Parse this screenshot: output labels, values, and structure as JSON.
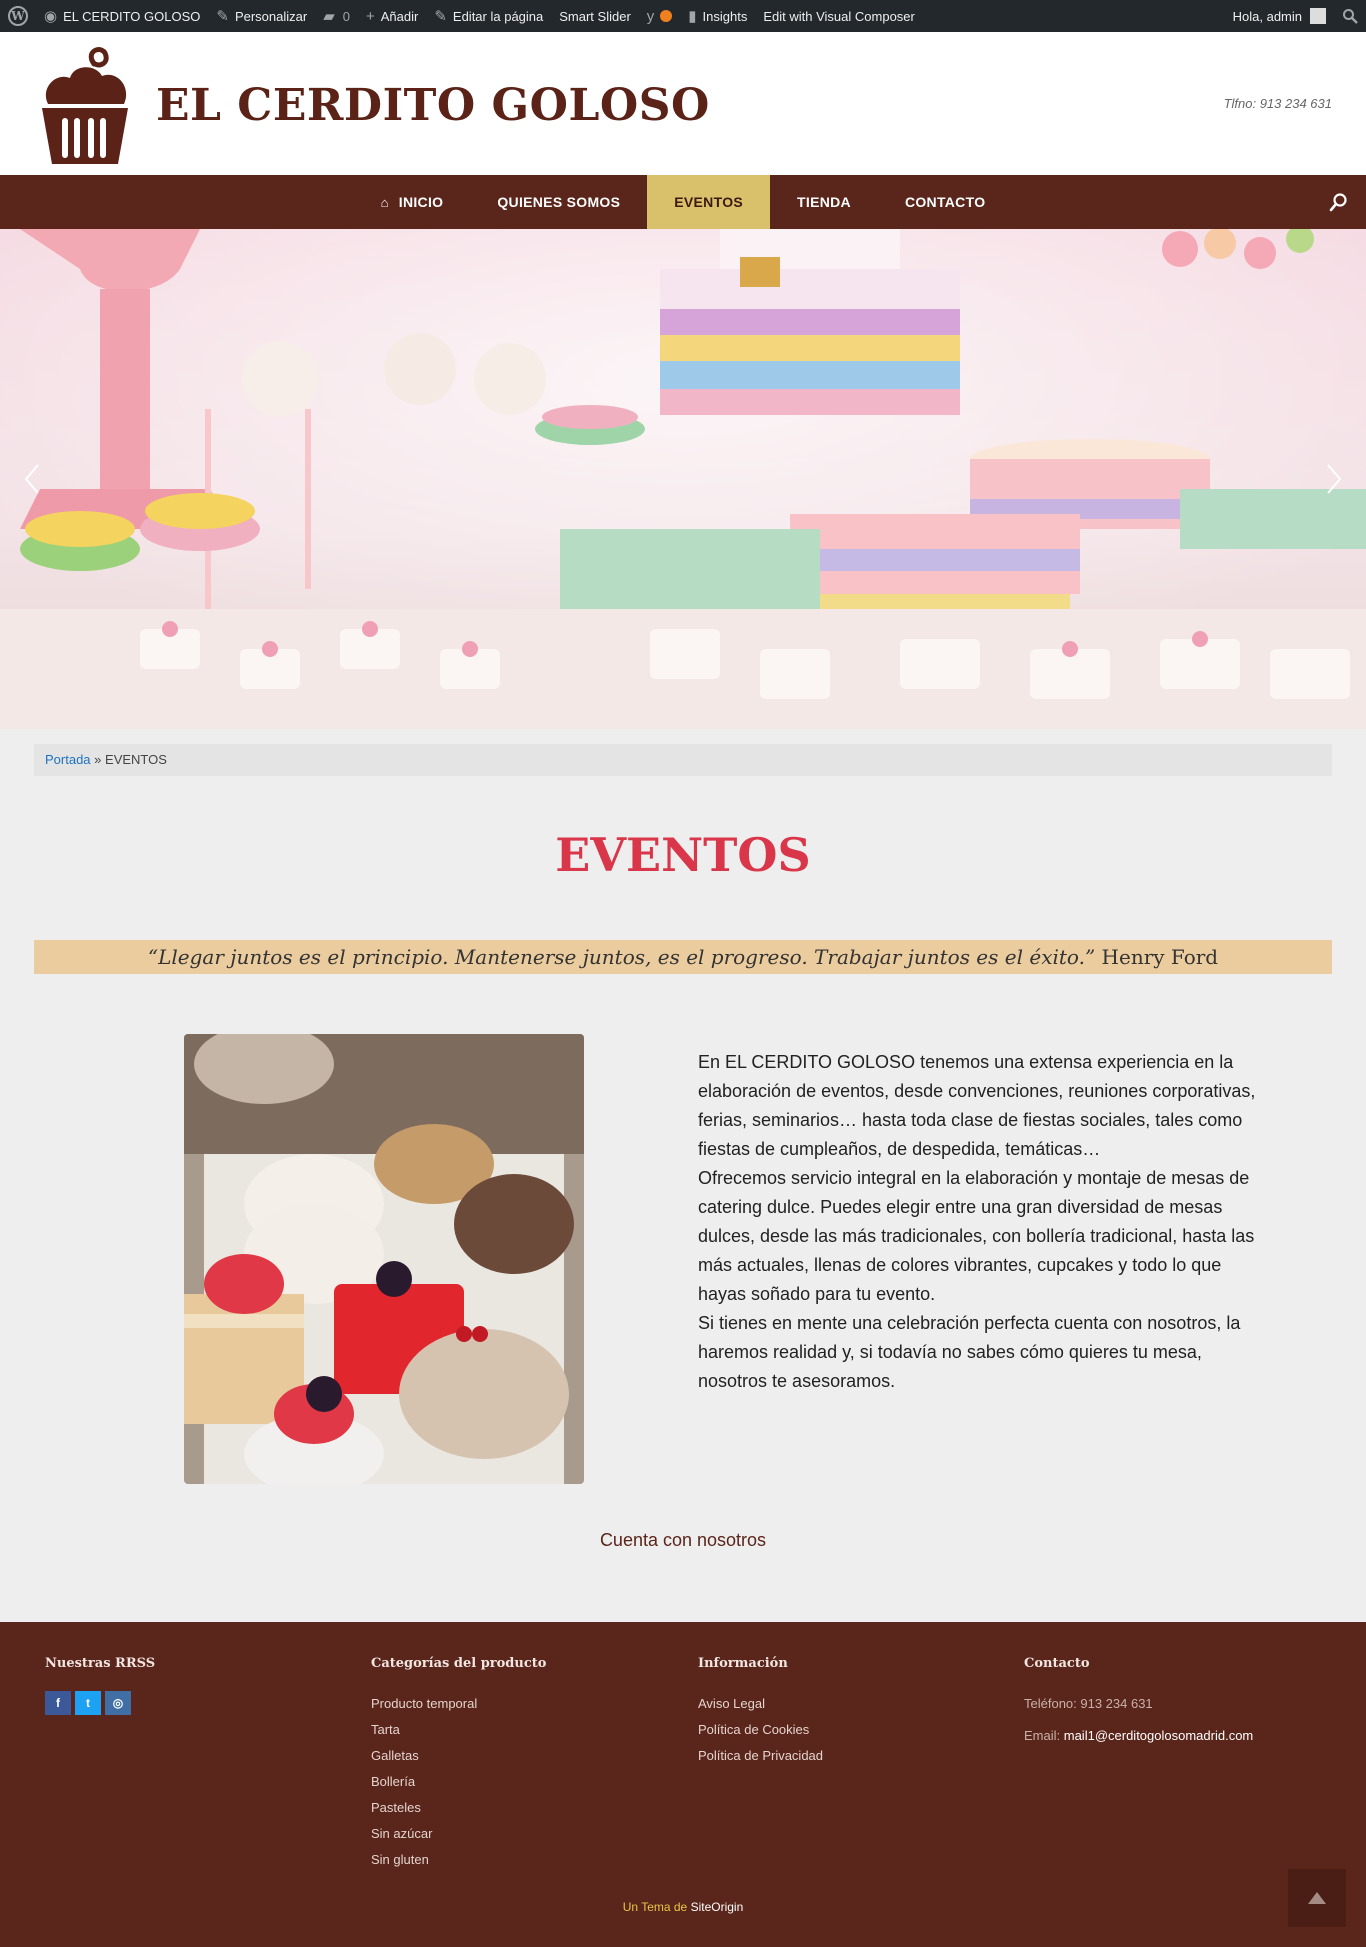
{
  "admin_bar": {
    "site_name": "EL CERDITO GOLOSO",
    "customize": "Personalizar",
    "comments_count": "0",
    "add_new": "Añadir",
    "edit_page": "Editar la página",
    "smart_slider": "Smart Slider",
    "insights": "Insights",
    "visual_composer": "Edit with Visual Composer",
    "greeting": "Hola, admin"
  },
  "header": {
    "site_title": "EL CERDITO GOLOSO",
    "phone": "Tlfno: 913 234 631"
  },
  "nav": {
    "items": [
      {
        "label": "INICIO"
      },
      {
        "label": "QUIENES SOMOS"
      },
      {
        "label": "EVENTOS"
      },
      {
        "label": "TIENDA"
      },
      {
        "label": "CONTACTO"
      }
    ]
  },
  "breadcrumb": {
    "home": "Portada",
    "separator": "»",
    "current": "EVENTOS"
  },
  "page": {
    "title": "EVENTOS",
    "quote_text": "“Llegar juntos es el principio. Mantenerse juntos, es el progreso. Trabajar juntos es el éxito.”",
    "quote_author": "Henry Ford",
    "paragraphs": [
      "En EL CERDITO GOLOSO tenemos una extensa experiencia en la elaboración de eventos, desde convenciones, reuniones corporativas, ferias, seminarios… hasta toda clase de fiestas sociales, tales como fiestas de cumpleaños, de despedida, temáticas…",
      "Ofrecemos servicio integral en la elaboración y montaje de mesas de catering dulce. Puedes elegir entre una gran diversidad de mesas dulces, desde las más tradicionales, con bollería tradicional, hasta las más actuales, llenas de colores vibrantes, cupcakes y todo lo que hayas soñado para tu evento.",
      "Si tienes en mente una celebración perfecta cuenta con nosotros, la haremos realidad y, si todavía no sabes cómo quieres tu mesa, nosotros te asesoramos."
    ],
    "cta": "Cuenta con nosotros"
  },
  "footer": {
    "rrss_title": "Nuestras RRSS",
    "social": [
      {
        "icon": "facebook-icon",
        "glyph": "f",
        "color": "#3b5998"
      },
      {
        "icon": "twitter-icon",
        "glyph": "t",
        "color": "#1da1f2"
      },
      {
        "icon": "instagram-icon",
        "glyph": "◎",
        "color": "#3f6fa5"
      }
    ],
    "categories_title": "Categorías del producto",
    "categories": [
      "Producto temporal",
      "Tarta",
      "Galletas",
      "Bollería",
      "Pasteles",
      "Sin azúcar",
      "Sin gluten"
    ],
    "info_title": "Información",
    "info_links": [
      "Aviso Legal",
      "Política de Cookies",
      "Política de Privacidad"
    ],
    "contact_title": "Contacto",
    "contact_phone": "Teléfono: 913 234 631",
    "contact_email_label": "Email:",
    "contact_email": "mail1@cerditogolosomadrid.com",
    "credit_prefix": "Un Tema de",
    "credit_brand": "SiteOrigin"
  },
  "colors": {
    "brand_brown": "#5a251a",
    "active_nav": "#d9c16b",
    "title_red": "#d9364a",
    "quote_bg": "#ebcc9f"
  }
}
